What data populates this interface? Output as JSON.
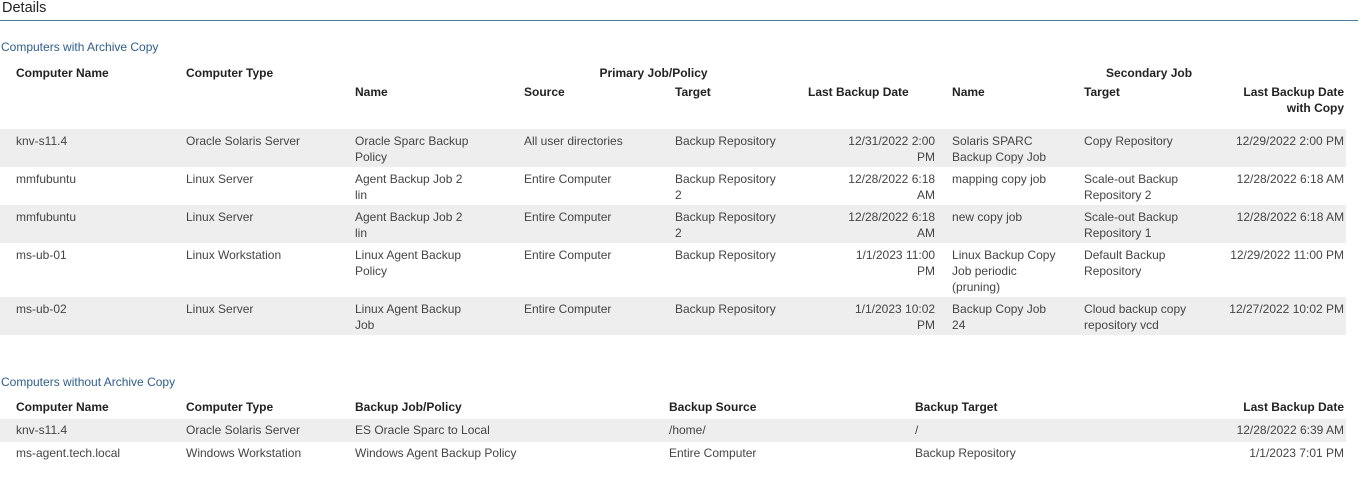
{
  "header": {
    "title": "Details"
  },
  "archive": {
    "title": "Computers with Archive Copy",
    "group_headers": {
      "computer_name": "Computer Name",
      "computer_type": "Computer Type",
      "primary": "Primary Job/Policy",
      "secondary": "Secondary Job"
    },
    "sub_headers": {
      "primary_name": "Name",
      "primary_source": "Source",
      "primary_target": "Target",
      "primary_last_backup": "Last Backup Date",
      "secondary_name": "Name",
      "secondary_target": "Target",
      "secondary_last_backup": "Last Backup Date with Copy"
    },
    "rows": [
      {
        "computer_name": "knv-s11.4",
        "computer_type": "Oracle Solaris Server",
        "primary_name": "Oracle Sparc Backup Policy",
        "primary_source": "All user directories",
        "primary_target": "Backup Repository",
        "primary_last_backup": "12/31/2022 2:00 PM",
        "secondary_name": "Solaris SPARC Backup Copy Job",
        "secondary_target": "Copy Repository",
        "secondary_last_backup": "12/29/2022 2:00 PM"
      },
      {
        "computer_name": "mmfubuntu",
        "computer_type": "Linux Server",
        "primary_name": "Agent Backup Job 2 lin",
        "primary_source": "Entire Computer",
        "primary_target": "Backup Repository 2",
        "primary_last_backup": "12/28/2022 6:18 AM",
        "secondary_name": "mapping copy job",
        "secondary_target": "Scale-out Backup Repository 2",
        "secondary_last_backup": "12/28/2022 6:18 AM"
      },
      {
        "computer_name": "mmfubuntu",
        "computer_type": "Linux Server",
        "primary_name": "Agent Backup Job 2 lin",
        "primary_source": "Entire Computer",
        "primary_target": "Backup Repository 2",
        "primary_last_backup": "12/28/2022 6:18 AM",
        "secondary_name": "new copy job",
        "secondary_target": "Scale-out Backup Repository 1",
        "secondary_last_backup": "12/28/2022 6:18 AM"
      },
      {
        "computer_name": "ms-ub-01",
        "computer_type": "Linux Workstation",
        "primary_name": "Linux Agent Backup Policy",
        "primary_source": "Entire Computer",
        "primary_target": "Backup Repository",
        "primary_last_backup": "1/1/2023 11:00 PM",
        "secondary_name": "Linux Backup Copy Job periodic (pruning)",
        "secondary_target": "Default Backup Repository",
        "secondary_last_backup": "12/29/2022 11:00 PM"
      },
      {
        "computer_name": "ms-ub-02",
        "computer_type": "Linux Server",
        "primary_name": "Linux Agent Backup Job",
        "primary_source": "Entire Computer",
        "primary_target": "Backup Repository",
        "primary_last_backup": "1/1/2023 10:02 PM",
        "secondary_name": "Backup Copy Job 24",
        "secondary_target": "Cloud backup copy repository vcd",
        "secondary_last_backup": "12/27/2022 10:02 PM"
      }
    ]
  },
  "no_archive": {
    "title": "Computers without Archive Copy",
    "headers": {
      "computer_name": "Computer Name",
      "computer_type": "Computer Type",
      "backup_job": "Backup Job/Policy",
      "backup_source": "Backup Source",
      "backup_target": "Backup Target",
      "last_backup": "Last Backup Date"
    },
    "rows": [
      {
        "computer_name": "knv-s11.4",
        "computer_type": "Oracle Solaris Server",
        "backup_job": "ES Oracle Sparc to Local",
        "backup_source": "/home/",
        "backup_target": "/",
        "last_backup": "12/28/2022 6:39 AM"
      },
      {
        "computer_name": "ms-agent.tech.local",
        "computer_type": "Windows Workstation",
        "backup_job": "Windows Agent Backup Policy",
        "backup_source": "Entire Computer",
        "backup_target": "Backup Repository",
        "last_backup": "1/1/2023 7:01 PM"
      }
    ]
  }
}
